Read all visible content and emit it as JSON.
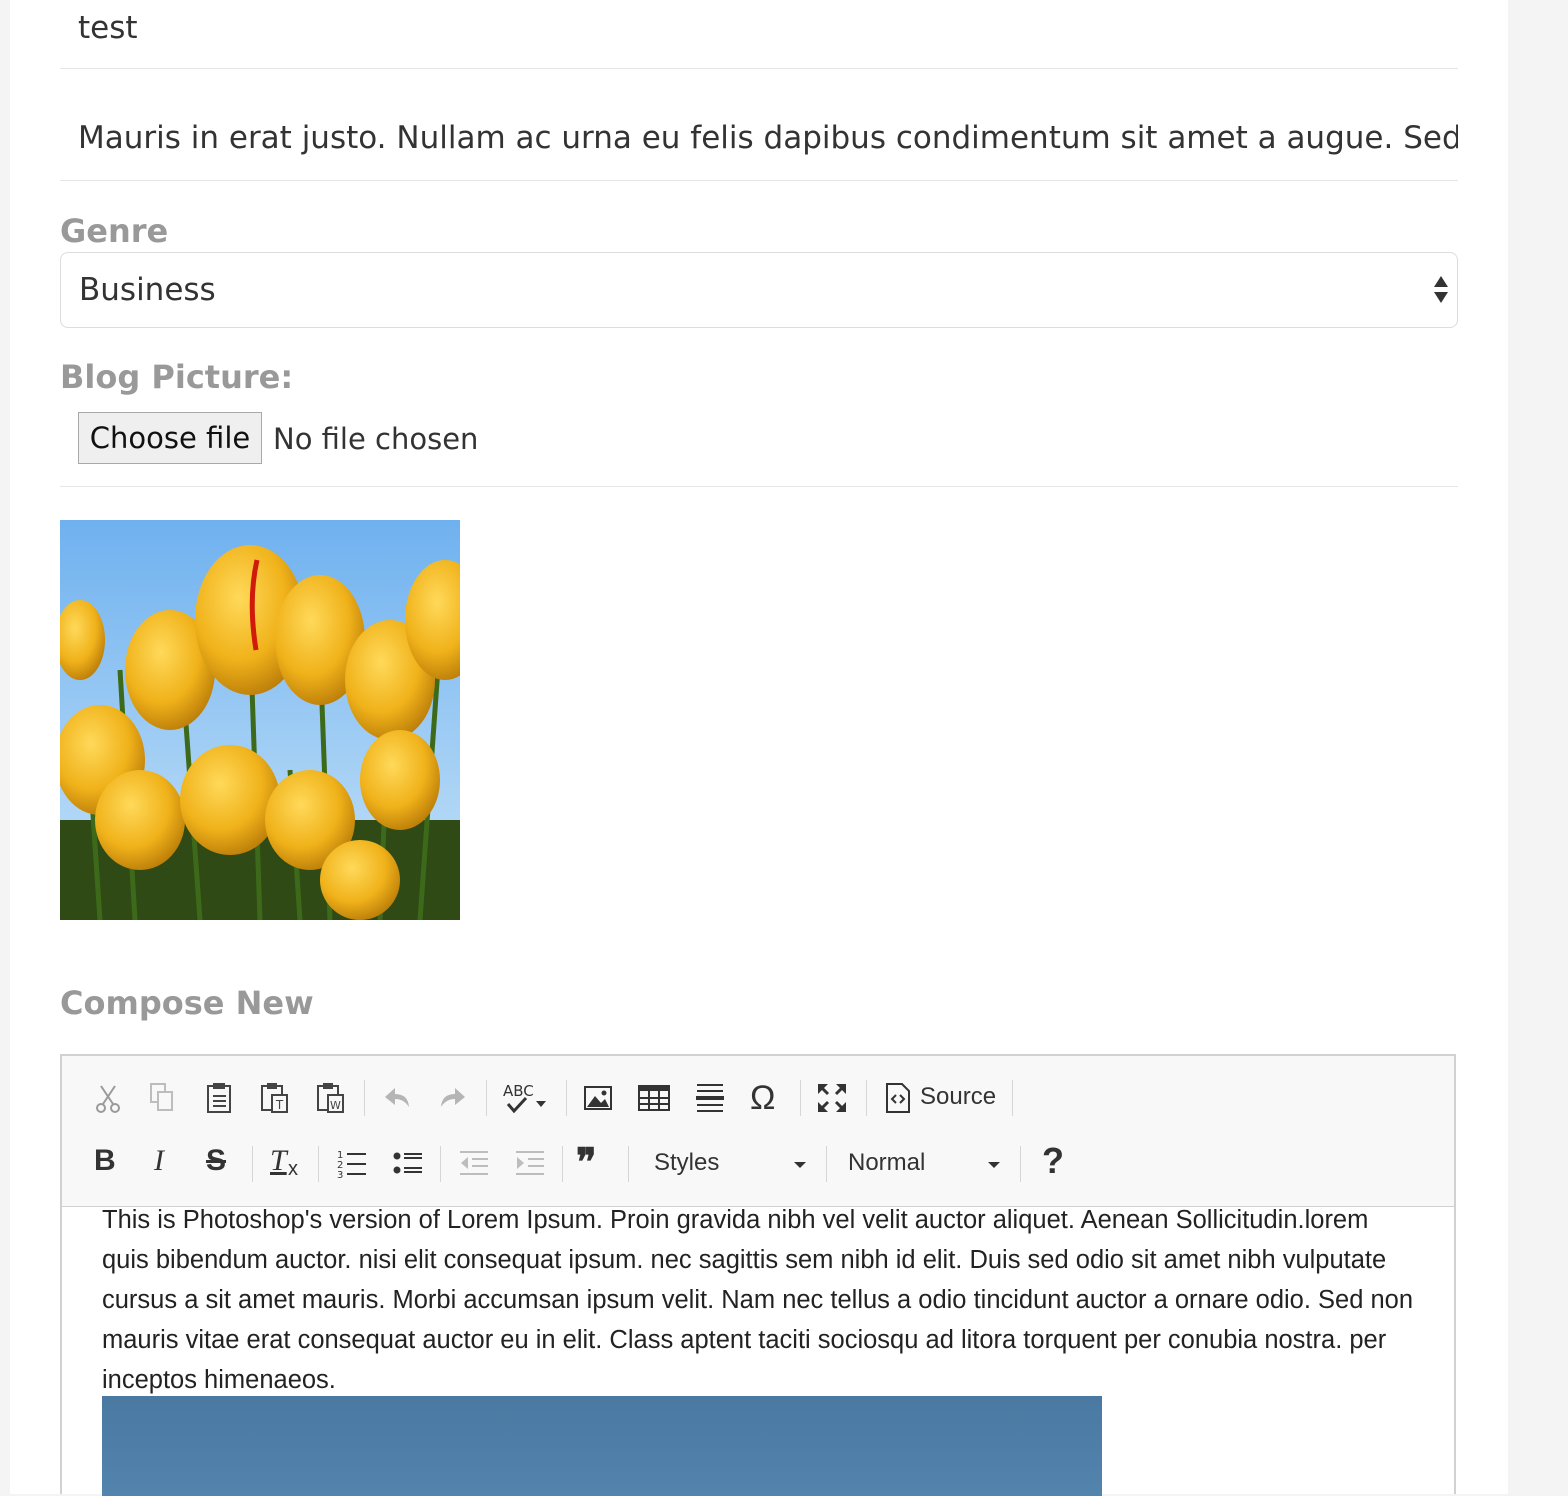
{
  "form": {
    "title_value": "test",
    "summary_value": "Mauris in erat justo. Nullam ac urna eu felis dapibus condimentum sit amet a augue. Sed non nec",
    "genre_label": "Genre",
    "genre_selected": "Business",
    "picture_label": "Blog Picture:",
    "file_button_label": "Choose file",
    "file_status": "No file chosen",
    "compose_label": "Compose New"
  },
  "editor": {
    "toolbar": {
      "row1_icons": [
        "cut-icon",
        "copy-icon",
        "paste-icon",
        "paste-text-icon",
        "paste-word-icon",
        "undo-icon",
        "redo-icon",
        "spellcheck-icon",
        "image-icon",
        "table-icon",
        "horizontal-line-icon",
        "special-char-icon",
        "maximize-icon",
        "source-icon"
      ],
      "source_label": "Source",
      "abc_text": "ABC",
      "omega": "Ω",
      "row2_icons": [
        "bold-icon",
        "italic-icon",
        "strike-icon",
        "remove-format-icon",
        "numbered-list-icon",
        "bulleted-list-icon",
        "outdent-icon",
        "indent-icon",
        "blockquote-icon",
        "help-icon"
      ],
      "bold_glyph": "B",
      "italic_glyph": "I",
      "strike_glyph": "S",
      "clear_glyph": "T",
      "clear_sub": "x",
      "quote_glyph": "❞",
      "help_glyph": "?",
      "styles_label": "Styles",
      "format_label": "Normal"
    },
    "body_text": "This is Photoshop's version of Lorem Ipsum. Proin gravida nibh vel velit auctor aliquet. Aenean Sollicitudin.lorem quis bibendum auctor. nisi elit consequat ipsum. nec sagittis sem nibh id elit. Duis sed odio sit amet nibh vulputate cursus a sit amet mauris. Morbi accumsan ipsum velit. Nam nec tellus a odio tincidunt auctor a ornare odio. Sed non mauris vitae erat consequat auctor eu in elit. Class aptent taciti sociosqu ad litora torquent per conubia nostra. per inceptos himenaeos."
  },
  "colors": {
    "label_gray": "#999999",
    "border": "#d1d1d1",
    "editor_image_blue": "#4a79a2"
  }
}
